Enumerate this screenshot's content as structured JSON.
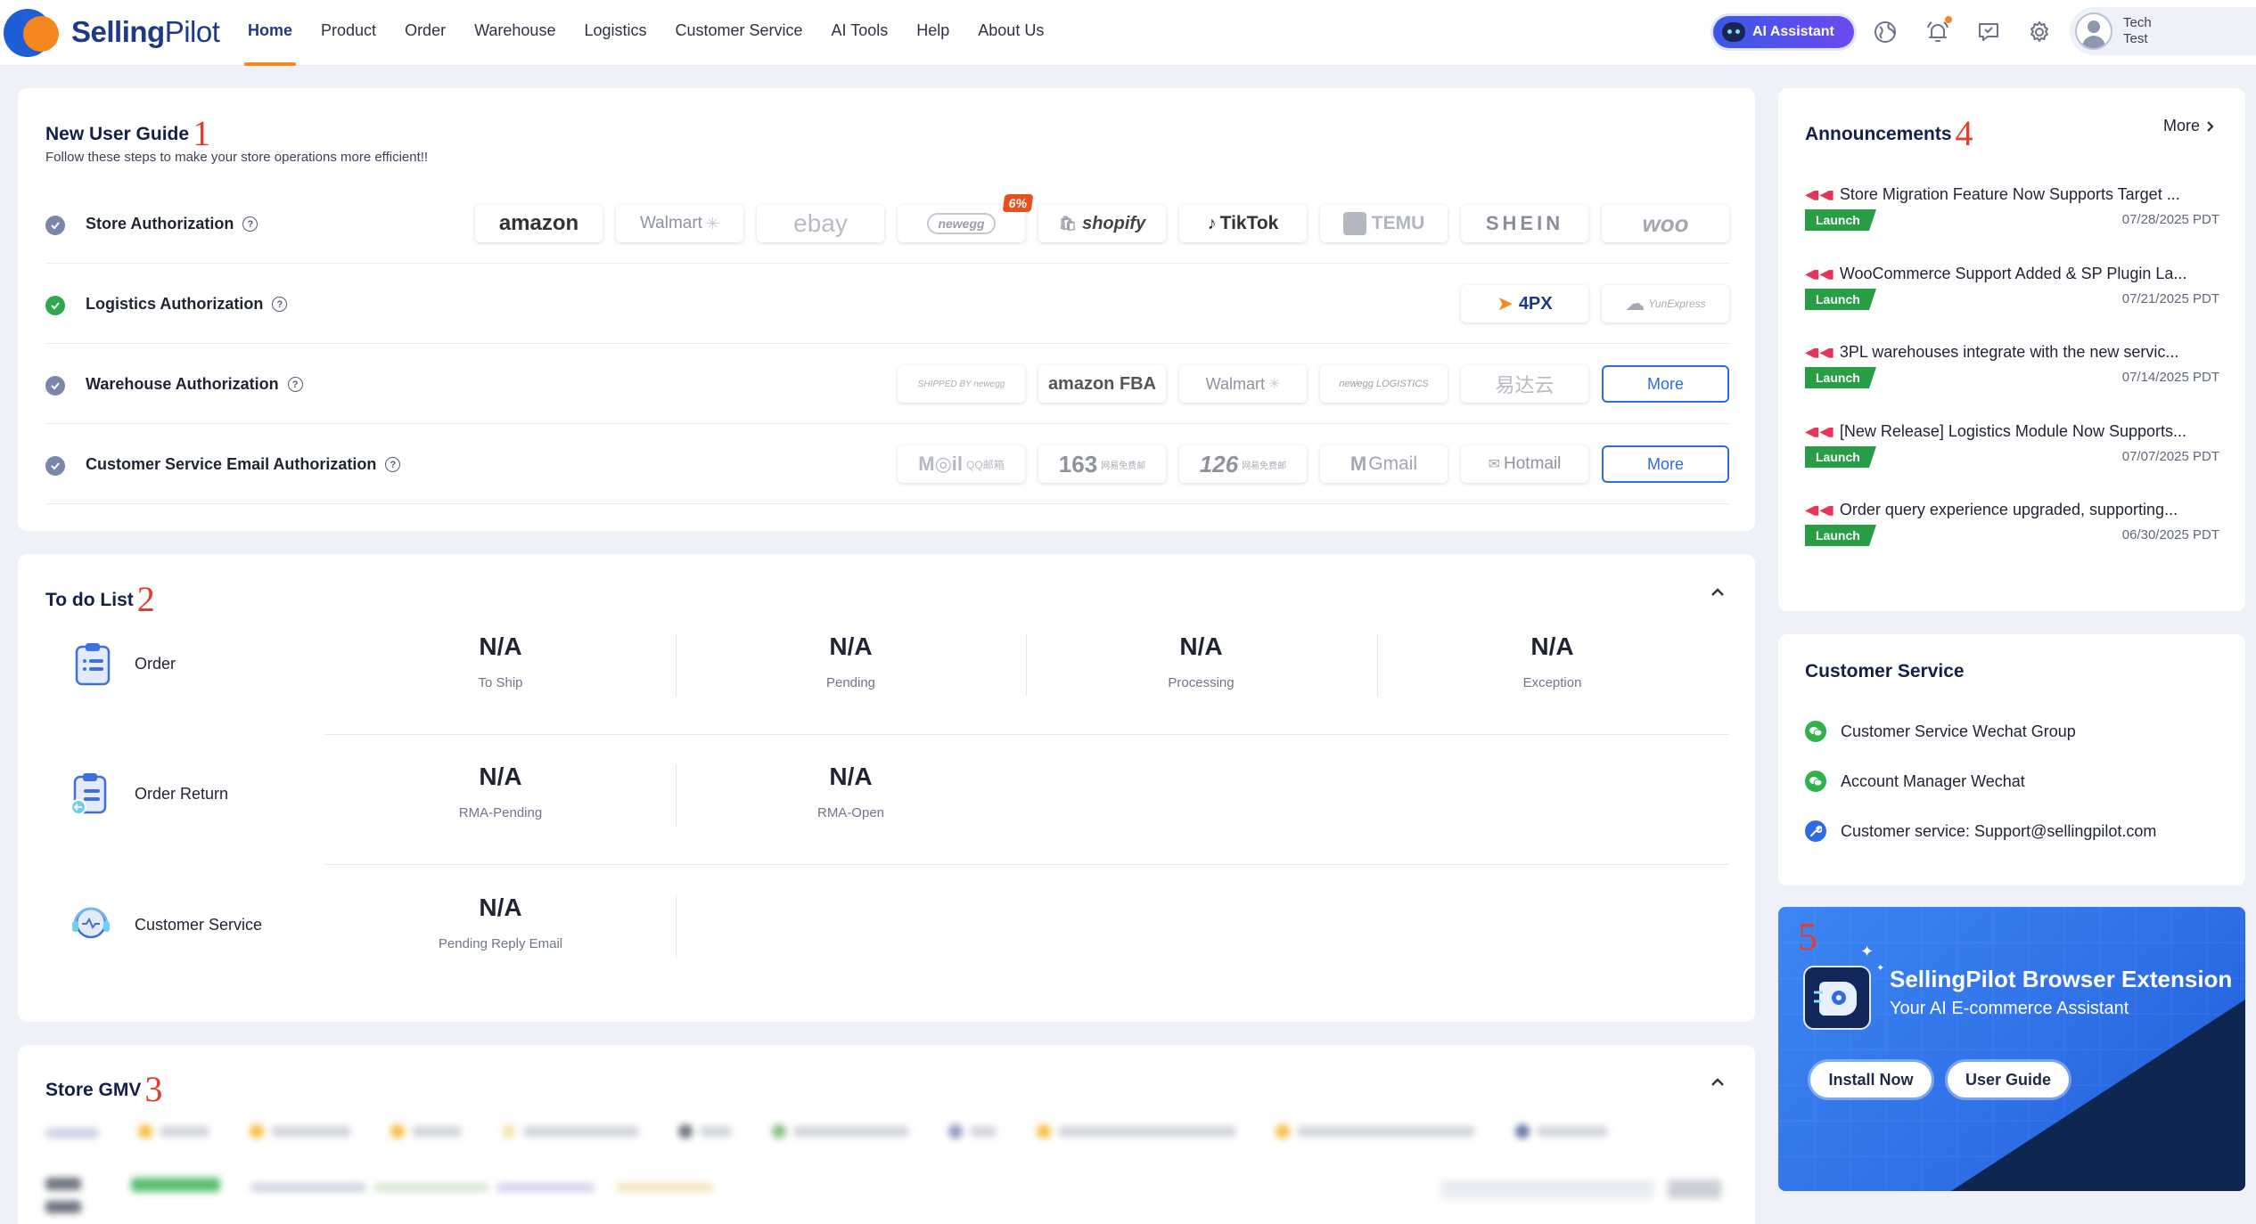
{
  "nav": {
    "brand_bold": "Selling",
    "brand_light": "Pilot",
    "items": [
      {
        "label": "Home",
        "active": true
      },
      {
        "label": "Product"
      },
      {
        "label": "Order"
      },
      {
        "label": "Warehouse"
      },
      {
        "label": "Logistics"
      },
      {
        "label": "Customer Service"
      },
      {
        "label": "AI Tools"
      },
      {
        "label": "Help"
      },
      {
        "label": "About Us"
      }
    ],
    "ai_assistant": "AI Assistant",
    "icons": [
      "globe-icon",
      "bell-icon",
      "message-icon",
      "gear-icon"
    ],
    "user": {
      "line1": "Tech",
      "line2": "Test"
    }
  },
  "guide": {
    "title": "New User Guide",
    "number": "1",
    "subtitle": "Follow these steps to make your store operations more efficient!!",
    "rows": [
      {
        "label": "Store Authorization",
        "logos": [
          "amazon",
          "Walmart",
          "ebay",
          "newegg",
          "shopify",
          "TikTok",
          "TEMU",
          "SHEIN",
          "woo"
        ],
        "badge": "6%"
      },
      {
        "label": "Logistics Authorization",
        "logos": [
          "4PX",
          "YunExpress"
        ]
      },
      {
        "label": "Warehouse Authorization",
        "logos": [
          "SHIPPED BY newegg",
          "amazon FBA",
          "Walmart",
          "newegg LOGISTICS",
          "易达云"
        ],
        "more": "More"
      },
      {
        "label": "Customer Service Email Authorization",
        "logos": [
          "QQ邮箱",
          "163",
          "126",
          "Gmail",
          "Hotmail"
        ],
        "more": "More"
      }
    ]
  },
  "todo": {
    "title": "To do List",
    "number": "2",
    "groups": [
      {
        "label": "Order",
        "stats": [
          {
            "value": "N/A",
            "label": "To Ship"
          },
          {
            "value": "N/A",
            "label": "Pending"
          },
          {
            "value": "N/A",
            "label": "Processing"
          },
          {
            "value": "N/A",
            "label": "Exception"
          }
        ]
      },
      {
        "label": "Order Return",
        "stats": [
          {
            "value": "N/A",
            "label": "RMA-Pending"
          },
          {
            "value": "N/A",
            "label": "RMA-Open"
          }
        ]
      },
      {
        "label": "Customer Service",
        "stats": [
          {
            "value": "N/A",
            "label": "Pending Reply Email"
          }
        ]
      }
    ]
  },
  "gmv": {
    "title": "Store GMV",
    "number": "3"
  },
  "announcements": {
    "title": "Announcements",
    "number": "4",
    "more": "More",
    "items": [
      {
        "title": "Store Migration Feature Now Supports Target ...",
        "tag": "Launch",
        "date": "07/28/2025 PDT"
      },
      {
        "title": "WooCommerce Support Added & SP Plugin La...",
        "tag": "Launch",
        "date": "07/21/2025 PDT"
      },
      {
        "title": "3PL warehouses integrate with the new servic...",
        "tag": "Launch",
        "date": "07/14/2025 PDT"
      },
      {
        "title": "[New Release] Logistics Module Now Supports...",
        "tag": "Launch",
        "date": "07/07/2025 PDT"
      },
      {
        "title": "Order query experience upgraded, supporting...",
        "tag": "Launch",
        "date": "06/30/2025 PDT"
      }
    ]
  },
  "customer_service": {
    "title": "Customer Service",
    "items": [
      {
        "label": "Customer Service Wechat Group",
        "icon": "wechat-icon"
      },
      {
        "label": "Account Manager Wechat",
        "icon": "wechat-icon"
      },
      {
        "label": "Customer service: Support@sellingpilot.com",
        "icon": "wrench-icon"
      }
    ]
  },
  "banner": {
    "number": "5",
    "title": "SellingPilot Browser Extension",
    "subtitle": "Your AI E-commerce Assistant",
    "install": "Install Now",
    "guide": "User Guide"
  },
  "colors": {
    "brand": "#1d3a8a",
    "accent": "#f5871f",
    "primary": "#2e6be6",
    "success": "#2a9d47",
    "red_label": "#e53b2b"
  }
}
